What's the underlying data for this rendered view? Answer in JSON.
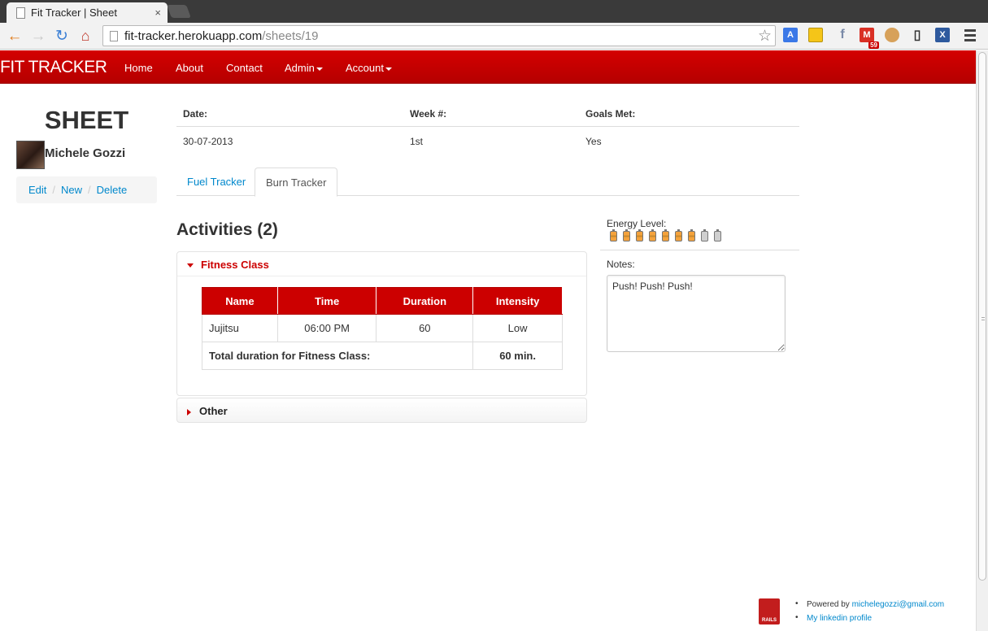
{
  "browser": {
    "tab_title": "Fit Tracker | Sheet",
    "tab_close": "×",
    "url_host": "fit-tracker.herokuapp.com",
    "url_path": "/sheets/19",
    "gmail_count": "59"
  },
  "navbar": {
    "brand": "FIT TRACKER",
    "links": [
      "Home",
      "About",
      "Contact",
      "Admin",
      "Account"
    ]
  },
  "sidebar": {
    "title": "SHEET",
    "user_name": "Michele Gozzi",
    "actions": [
      "Edit",
      "New",
      "Delete"
    ],
    "separator": "/"
  },
  "info": {
    "headers": [
      "Date:",
      "Week #:",
      "Goals Met:"
    ],
    "values": [
      "30-07-2013",
      "1st",
      "Yes"
    ]
  },
  "tabs": [
    "Fuel Tracker",
    "Burn Tracker"
  ],
  "active_tab": "Burn Tracker",
  "activities": {
    "title": "Activities (2)",
    "groups": [
      {
        "name": "Fitness Class",
        "expanded": true,
        "columns": [
          "Name",
          "Time",
          "Duration",
          "Intensity"
        ],
        "rows": [
          [
            "Jujitsu",
            "06:00 PM",
            "60",
            "Low"
          ]
        ],
        "total_label": "Total duration for Fitness Class:",
        "total_value": "60 min."
      },
      {
        "name": "Other",
        "expanded": false
      }
    ]
  },
  "energy": {
    "label": "Energy Level:",
    "level": 7,
    "max": 9
  },
  "notes": {
    "label": "Notes:",
    "value": "Push! Push! Push!"
  },
  "footer": {
    "logo_text": "RAILS",
    "powered_by": "Powered by",
    "email": "michelegozzi@gmail.com",
    "linkedin": "My linkedin profile"
  },
  "colors": {
    "brand_red": "#cc0000",
    "link_blue": "#0088cc"
  }
}
